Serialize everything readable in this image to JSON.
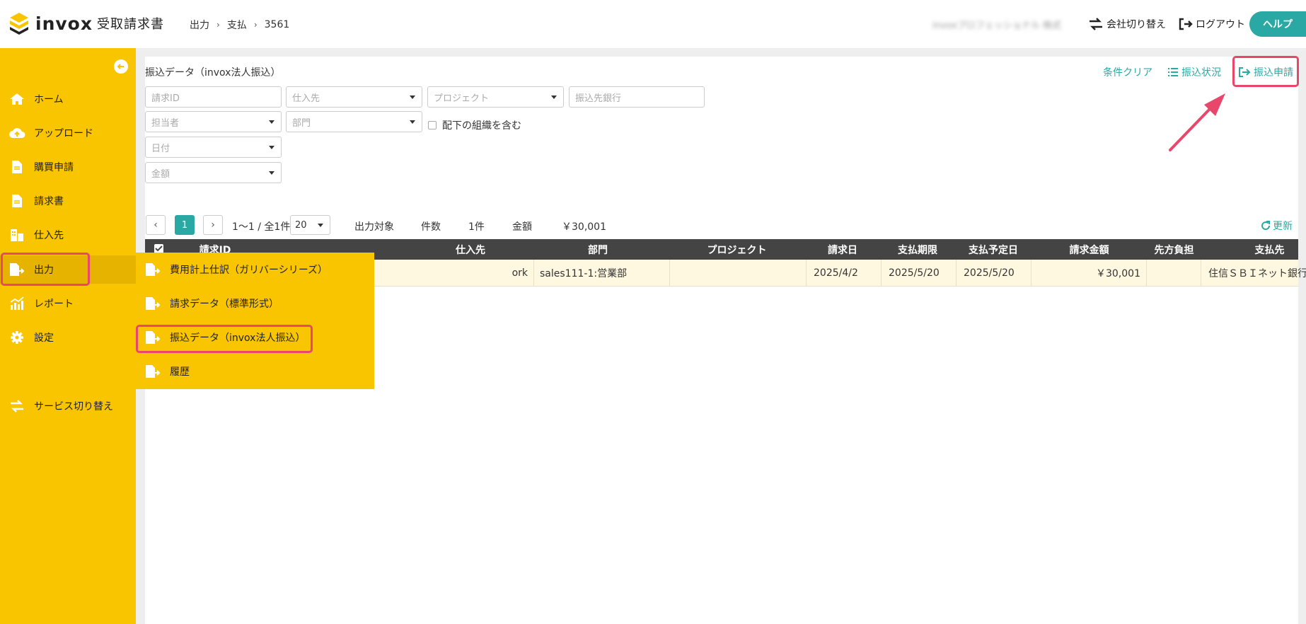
{
  "header": {
    "logo_text": "invox",
    "logo_sub": "受取請求書",
    "breadcrumb": [
      "出力",
      "支払",
      "3561"
    ],
    "company_name": "invoxプロフェッショナル 株式",
    "switch_company": "会社切り替え",
    "logout": "ログアウト",
    "help": "ヘルプ"
  },
  "sidebar": {
    "items": [
      {
        "label": "ホーム",
        "icon": "home-icon"
      },
      {
        "label": "アップロード",
        "icon": "cloud-upload-icon"
      },
      {
        "label": "購買申請",
        "icon": "document-icon"
      },
      {
        "label": "請求書",
        "icon": "document-icon"
      },
      {
        "label": "仕入先",
        "icon": "building-icon"
      },
      {
        "label": "出力",
        "icon": "file-export-icon"
      },
      {
        "label": "レポート",
        "icon": "chart-icon"
      },
      {
        "label": "設定",
        "icon": "gear-icon"
      },
      {
        "label": "サービス切り替え",
        "icon": "switch-icon"
      }
    ]
  },
  "submenu": {
    "items": [
      {
        "label": "費用計上仕訳（ガリバーシリーズ）"
      },
      {
        "label": "請求データ（標準形式）"
      },
      {
        "label": "振込データ（invox法人振込）"
      },
      {
        "label": "履歴"
      }
    ]
  },
  "panel": {
    "title": "振込データ（invox法人振込）",
    "clear_conditions": "条件クリア",
    "transfer_status": "振込状況",
    "transfer_request": "振込申請"
  },
  "filters": {
    "invoice_id": "請求ID",
    "supplier": "仕入先",
    "project": "プロジェクト",
    "bank": "振込先銀行",
    "assignee": "担当者",
    "department": "部門",
    "include_sub": "配下の組織を含む",
    "date": "日付",
    "amount": "金額"
  },
  "pager": {
    "current": "1",
    "range": "1〜1 / 全1件",
    "per_page": "20",
    "target_label": "出力対象",
    "count_label": "件数",
    "count_value": "1件",
    "amount_label": "金額",
    "amount_value": "￥30,001",
    "refresh": "更新"
  },
  "table": {
    "headers": [
      "請求ID",
      "仕入先",
      "部門",
      "プロジェクト",
      "請求日",
      "支払期限",
      "支払予定日",
      "請求金額",
      "先方負担",
      "支払先"
    ],
    "rows": [
      {
        "supplier": "ork",
        "department": "sales111-1:営業部",
        "project": "",
        "invoice_date": "2025/4/2",
        "due_date": "2025/5/20",
        "scheduled_date": "2025/5/20",
        "amount": "￥30,001",
        "burden": "",
        "payee": "住信ＳＢＩネット銀行"
      }
    ]
  },
  "colors": {
    "accent": "#2aa8a4",
    "sidebar": "#f9c400",
    "highlight": "#e8466a"
  }
}
